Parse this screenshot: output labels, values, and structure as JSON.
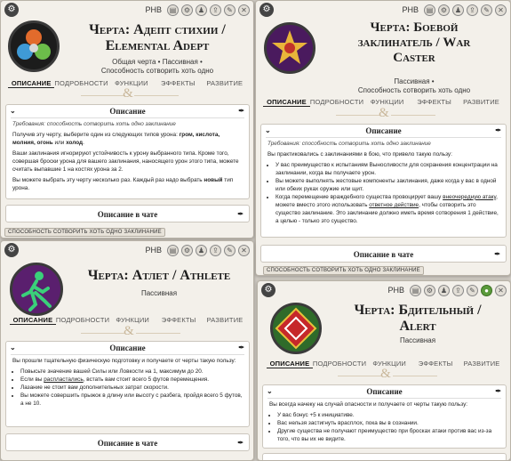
{
  "common": {
    "source": "PHB",
    "chat_label": "Описание в чате",
    "desc_label": "Описание",
    "tag": "СПОСОБНОСТЬ СОТВОРИТЬ ХОТЬ ОДНО ЗАКЛИНАНИЕ",
    "req": "Требования: способность сотворить хоть одно заклинание"
  },
  "tabs": [
    "ОПИСАНИЕ",
    "ПОДРОБНОСТИ",
    "ФУНКЦИИ",
    "ЭФФЕКТЫ",
    "РАЗВИТИЕ"
  ],
  "p1": {
    "title1": "Черта: Адепт стихии /",
    "title2": "Elemental Adept",
    "sub1": "Общая черта • Пассивная •",
    "sub2": "Способность сотворить хоть одно",
    "para1a": "Получив эту черту, выберите один из следующих типов урона: ",
    "para1b": "гром, кислота, молния, огонь",
    "para1c": " или ",
    "para1d": "холод",
    "para2": "Ваши заклинания игнорируют устойчивость к урону выбранного типа. Кроме того, совершая броски урона для вашего заклинания, наносящего урон этого типа, можете считать выпавшие 1 на костях урона за 2.",
    "para3a": "Вы можете выбрать эту черту несколько раз. Каждый раз надо выбрать ",
    "para3b": "новый",
    "para3c": " тип урона."
  },
  "p2": {
    "title1": "Черта: Боевой",
    "title2": "заклинатель / War",
    "title3": "Caster",
    "sub1": "Пассивная •",
    "sub2": "Способность сотворить хоть одно",
    "intro": "Вы практиковались с заклинаниями в бою, что привело такую пользу:",
    "b1": "У вас преимущество к испытаниям Выносливости для сохранения концентрации на заклинании, когда вы получаете урон.",
    "b2": "Вы можете выполнять жестовые компоненты заклинания, даже когда у вас в одной или обеих руках оружие или щит.",
    "b3a": "Когда перемещение враждебного существа провоцирует вашу",
    "b3link1": "внеочередную атаку",
    "b3b": ", можете вместо этого использовать",
    "b3link2": "ответное действие",
    "b3c": ", чтобы сотворить это существо заклинание. Это заклинание должно иметь время сотворения 1 действие, а целью - только это существо."
  },
  "p3": {
    "title": "Черта: Атлет / Athlete",
    "sub": "Пассивная",
    "intro": "Вы прошли тщательную физическую подготовку и получаете от черты такую пользу:",
    "b1": "Повысьте значение вашей Силы или Ловкости на 1, максимум до 20.",
    "b2a": "Если вы ",
    "b2link": "распластались",
    "b2b": ", встать вам стоит всего 5 футов перемещения.",
    "b3": "Лазание не стоит вам дополнительных затрат скорости.",
    "b4": "Вы можете совершить прыжок в длину или высоту с разбега, пройдя всего 5 футов, а не 10."
  },
  "p4": {
    "title1": "Черта: Бдительный /",
    "title2": "Alert",
    "sub": "Пассивная",
    "intro": "Вы всегда начеку на случай опасности и получаете от черты такую пользу:",
    "b1": "У вас бонус +5 к инициативе.",
    "b2": "Вас нельзя застигнуть врасплох, пока вы в сознании.",
    "b3": "Другие существа не получают преимущество при бросках атаки против вас из-за того, что вы их не видите."
  },
  "colors": {
    "panel": "#f3f0ea",
    "accent": "#c9b79a",
    "title": "#1d1d1d"
  }
}
